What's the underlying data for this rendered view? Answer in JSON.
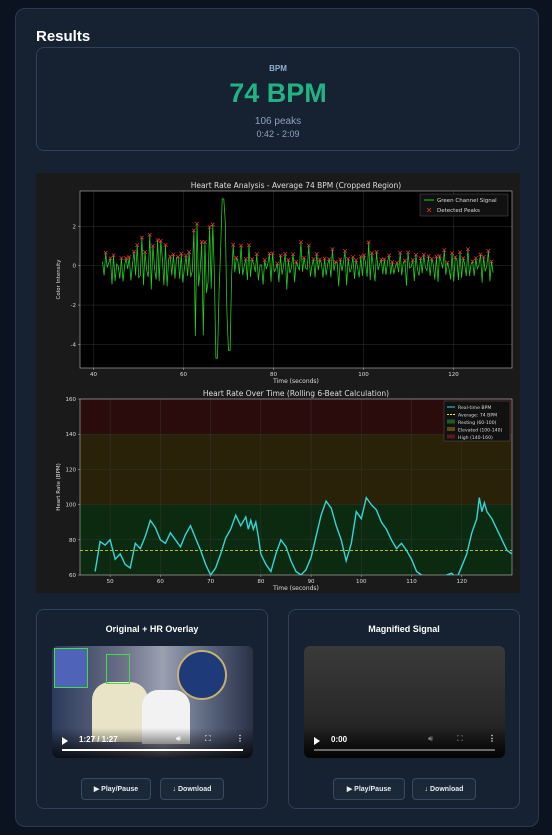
{
  "results": {
    "title": "Results",
    "bpm_label": "BPM",
    "bpm_value": "74 BPM",
    "peaks": "106 peaks",
    "range": "0:42 - 2:09"
  },
  "chart_data": [
    {
      "type": "line",
      "title": "Heart Rate Analysis - Average 74 BPM (Cropped Region)",
      "xlabel": "Time (seconds)",
      "ylabel": "Color Intensity",
      "xlim": [
        37,
        133
      ],
      "ylim": [
        -5.2,
        3.8
      ],
      "xticks": [
        40,
        60,
        80,
        100,
        120
      ],
      "yticks": [
        -4,
        -2,
        0,
        2
      ],
      "legend_position": "top-right",
      "grid": true,
      "series": [
        {
          "name": "Green Channel Signal",
          "color": "#22cc22"
        },
        {
          "name": "Detected Peaks",
          "color": "#ee3333",
          "marker": "x"
        }
      ]
    },
    {
      "type": "line",
      "title": "Heart Rate Over Time (Rolling 6-Beat Calculation)",
      "xlabel": "Time (seconds)",
      "ylabel": "Heart Rate (BPM)",
      "xlim": [
        44,
        130
      ],
      "ylim": [
        60,
        160
      ],
      "xticks": [
        50,
        60,
        70,
        80,
        90,
        100,
        110,
        120
      ],
      "yticks": [
        60,
        80,
        100,
        120,
        140,
        160
      ],
      "legend_position": "top-right",
      "grid": true,
      "average": 74,
      "zones": [
        {
          "name": "Resting (60-100)",
          "from": 60,
          "to": 100,
          "color": "#0c2a10"
        },
        {
          "name": "Elevated (100-140)",
          "from": 100,
          "to": 140,
          "color": "#2a2208"
        },
        {
          "name": "High (140-160)",
          "from": 140,
          "to": 160,
          "color": "#2a0c0c"
        }
      ],
      "series": [
        {
          "name": "Real-time BPM",
          "color": "#33d6d6"
        },
        {
          "name": "Average: 74 BPM",
          "color": "#e8e84a"
        }
      ],
      "x": [
        47,
        48,
        49,
        50,
        51,
        52,
        53,
        54,
        55,
        56,
        57,
        58,
        59,
        60,
        61,
        62,
        63,
        64,
        65,
        66,
        67,
        68,
        69,
        70,
        71,
        72,
        73,
        74,
        75,
        76,
        77,
        77.5,
        78,
        78.5,
        79,
        79.5,
        80,
        81,
        82,
        83,
        84,
        85,
        86,
        87,
        88,
        89,
        90,
        91,
        92,
        93,
        94,
        95,
        96,
        97,
        98,
        99,
        100,
        101,
        102,
        103,
        104,
        105,
        106,
        107,
        108,
        109,
        110,
        111,
        112,
        113,
        114,
        115,
        116,
        117,
        118,
        119,
        120,
        121,
        122,
        123,
        123.5,
        124,
        124.5,
        125,
        126,
        127,
        128,
        129,
        130
      ],
      "y": [
        62,
        79,
        77,
        80,
        69,
        72,
        66,
        64,
        78,
        75,
        82,
        91,
        87,
        80,
        78,
        84,
        80,
        76,
        83,
        88,
        81,
        74,
        66,
        60,
        64,
        72,
        81,
        86,
        94,
        88,
        93,
        86,
        91,
        86,
        90,
        82,
        72,
        66,
        62,
        72,
        80,
        76,
        68,
        62,
        60,
        63,
        70,
        82,
        94,
        102,
        98,
        88,
        80,
        68,
        78,
        96,
        92,
        104,
        100,
        97,
        90,
        86,
        80,
        75,
        78,
        74,
        69,
        62,
        60,
        58,
        54,
        58,
        57,
        60,
        61,
        58,
        65,
        72,
        84,
        92,
        104,
        96,
        101,
        96,
        92,
        86,
        80,
        74,
        72
      ]
    }
  ],
  "left_video": {
    "title": "Original + HR Overlay",
    "time": "1:27 / 1:27",
    "play_label": "▶ Play/Pause",
    "download_label": "↓ Download",
    "progress": 1.0
  },
  "right_video": {
    "title": "Magnified Signal",
    "time": "0:00",
    "play_label": "▶ Play/Pause",
    "download_label": "↓ Download",
    "progress": 0.0
  }
}
